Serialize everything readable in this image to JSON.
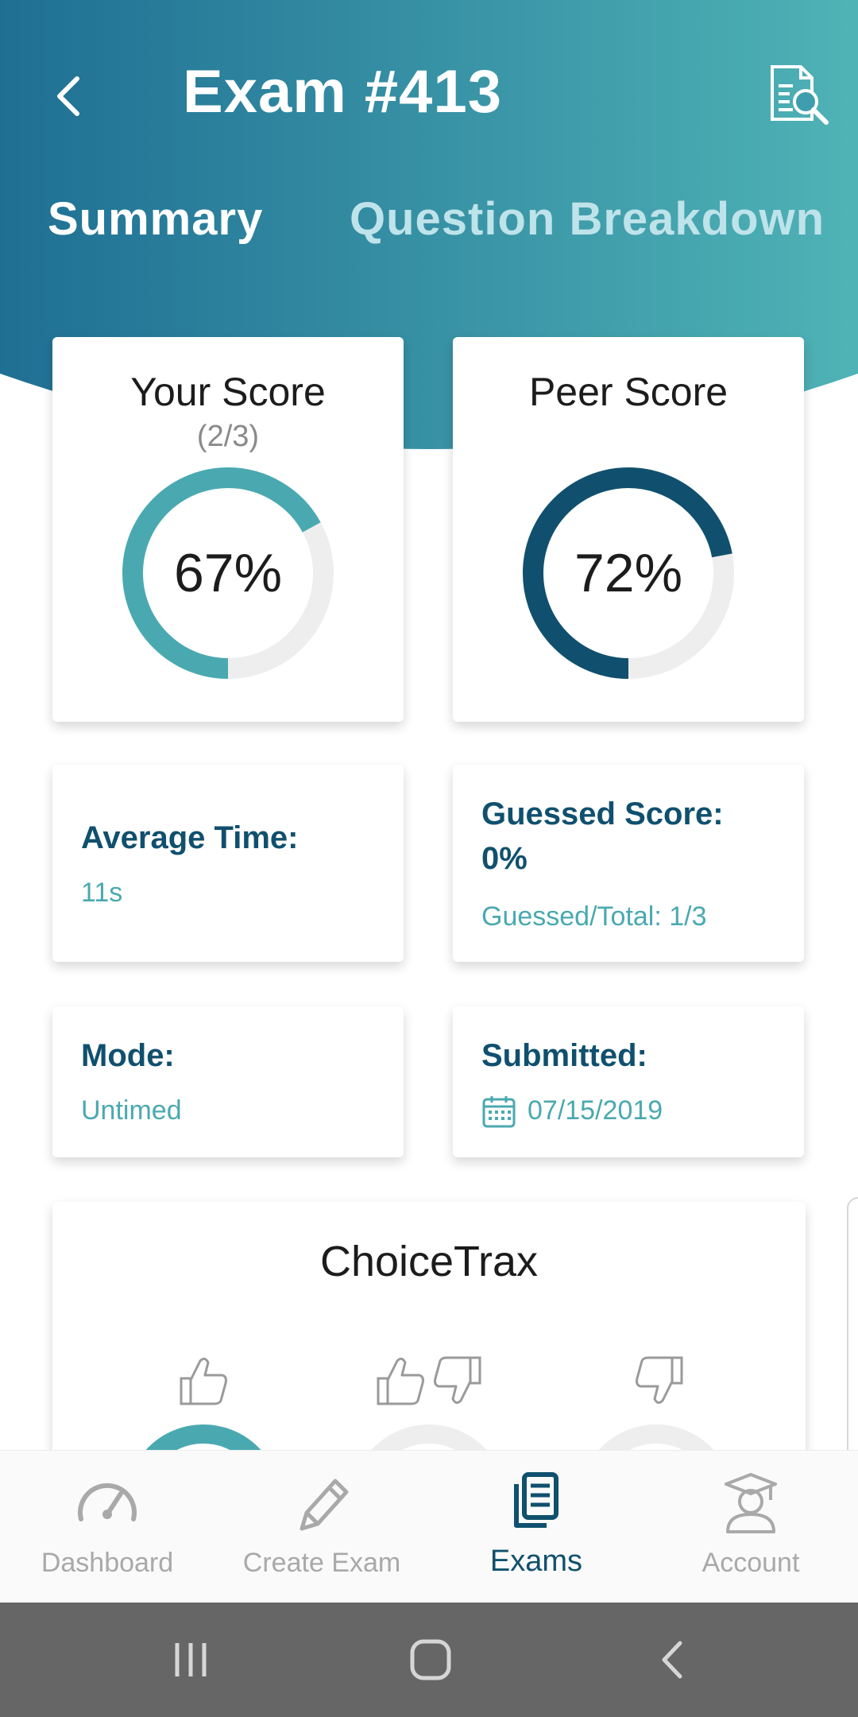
{
  "header": {
    "title": "Exam #413",
    "back_icon": "chevron-left-icon",
    "report_icon": "document-search-icon",
    "gradient": [
      "#1f6f93",
      "#4fb3b6"
    ]
  },
  "tabs": [
    {
      "label": "Summary",
      "active": true
    },
    {
      "label": "Question Breakdown",
      "active": false
    }
  ],
  "scores": {
    "yours": {
      "title": "Your Score",
      "fraction": "(2/3)",
      "percent_label": "67%",
      "percent": 67,
      "color": "#4aa9b0"
    },
    "peer": {
      "title": "Peer Score",
      "percent_label": "72%",
      "percent": 72,
      "color": "#10506e"
    }
  },
  "stats": {
    "average_time": {
      "label": "Average Time:",
      "value": "11s"
    },
    "guessed": {
      "label": "Guessed Score:",
      "value": "0%",
      "detail": "Guessed/Total: 1/3"
    },
    "mode": {
      "label": "Mode:",
      "value": "Untimed"
    },
    "submitted": {
      "label": "Submitted:",
      "value": "07/15/2019",
      "icon": "calendar-icon"
    }
  },
  "choicetrax": {
    "title": "ChoiceTrax",
    "icons": [
      "thumbs-up-icon",
      "thumbs-up-down-icon",
      "thumbs-down-icon"
    ]
  },
  "bottom_nav": [
    {
      "label": "Dashboard",
      "icon": "speedometer-icon",
      "active": false
    },
    {
      "label": "Create Exam",
      "icon": "pencil-icon",
      "active": false
    },
    {
      "label": "Exams",
      "icon": "documents-icon",
      "active": true
    },
    {
      "label": "Account",
      "icon": "graduate-icon",
      "active": false
    }
  ],
  "system_nav": [
    "recent-apps-icon",
    "home-icon",
    "back-icon"
  ],
  "colors": {
    "accent": "#4aa9b0",
    "primary": "#10506e",
    "muted": "#a9a9a9"
  }
}
